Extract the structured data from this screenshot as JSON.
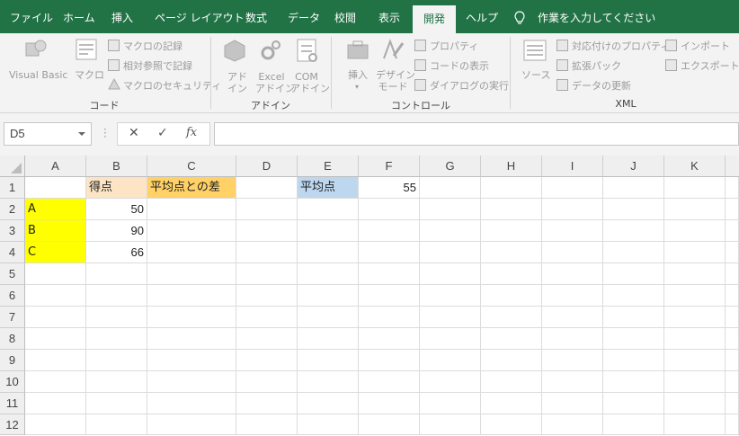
{
  "menu": {
    "tabs": [
      "ファイル",
      "ホーム",
      "挿入",
      "ページ レイアウト",
      "数式",
      "データ",
      "校閲",
      "表示",
      "開発",
      "ヘルプ"
    ],
    "active_tab": "開発",
    "tell_me": "作業を入力してください"
  },
  "ribbon": {
    "code": {
      "label": "コード",
      "visual_basic": "Visual Basic",
      "macro": "マクロ",
      "record_macro": "マクロの記録",
      "relative_ref": "相対参照で記録",
      "macro_security": "マクロのセキュリティ"
    },
    "addins": {
      "label": "アドイン",
      "addin": [
        "アド",
        "イン"
      ],
      "excel_addin": [
        "Excel",
        "アドイン"
      ],
      "com_addin": [
        "COM",
        "アドイン"
      ]
    },
    "controls": {
      "label": "コントロール",
      "insert": "挿入",
      "design_mode": [
        "デザイン",
        "モード"
      ],
      "properties": "プロパティ",
      "view_code": "コードの表示",
      "run_dialog": "ダイアログの実行"
    },
    "xml": {
      "label": "XML",
      "source": "ソース",
      "map_properties": "対応付けのプロパティ",
      "expansion_packs": "拡張パック",
      "refresh_data": "データの更新",
      "import": "インポート",
      "export": "エクスポート"
    }
  },
  "formula_bar": {
    "name_box": "D5",
    "formula": "",
    "cancel": "✕",
    "enter": "✓",
    "fx": "fx"
  },
  "sheet": {
    "columns": [
      "A",
      "B",
      "C",
      "D",
      "E",
      "F",
      "G",
      "H",
      "I",
      "J",
      "K"
    ],
    "rows": [
      "1",
      "2",
      "3",
      "4",
      "5",
      "6",
      "7",
      "8",
      "9",
      "10",
      "11",
      "12"
    ],
    "cells": {
      "B1": "得点",
      "C1": "平均点との差",
      "E1": "平均点",
      "F1": "55",
      "A2": "A",
      "B2": "50",
      "A3": "B",
      "B3": "90",
      "A4": "C",
      "B4": "66"
    }
  }
}
